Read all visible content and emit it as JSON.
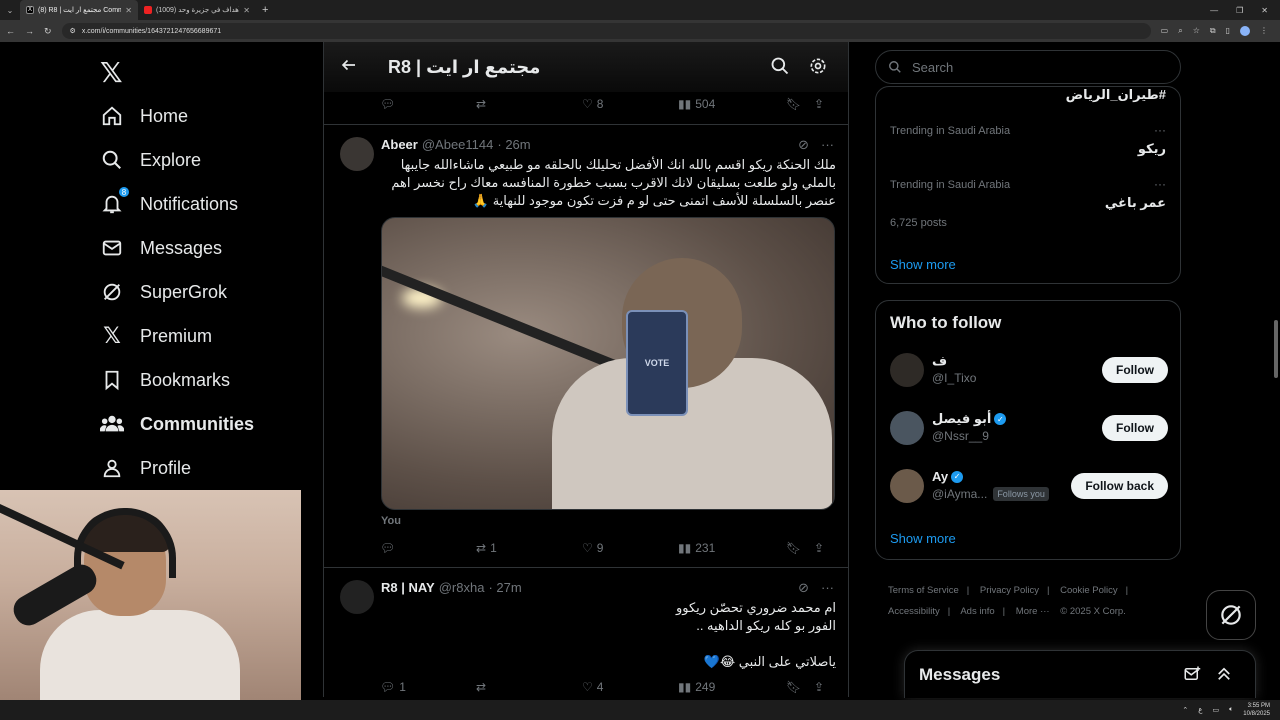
{
  "browser": {
    "tabs": [
      {
        "title": "(8) R8 | مجتمع ار ايت Communi...",
        "active": true
      },
      {
        "title": "(1009) كل الأهداف في جزيرة وحد...",
        "active": false
      }
    ],
    "url": "x.com/i/communities/1643721247656689671"
  },
  "sidebar": {
    "notifications_badge": "8",
    "items": [
      {
        "label": "Home",
        "icon": "home-icon"
      },
      {
        "label": "Explore",
        "icon": "search-icon"
      },
      {
        "label": "Notifications",
        "icon": "bell-icon"
      },
      {
        "label": "Messages",
        "icon": "mail-icon"
      },
      {
        "label": "SuperGrok",
        "icon": "grok-icon"
      },
      {
        "label": "Premium",
        "icon": "x-premium-icon"
      },
      {
        "label": "Bookmarks",
        "icon": "bookmark-icon"
      },
      {
        "label": "Communities",
        "icon": "communities-icon"
      },
      {
        "label": "Profile",
        "icon": "profile-icon"
      }
    ]
  },
  "header": {
    "title": "R8 | مجتمع ار ايت"
  },
  "posts": [
    {
      "stats": {
        "replies": "",
        "reposts": "",
        "likes": "8",
        "views": "504"
      }
    },
    {
      "name": "Abeer",
      "handle": "@Abee1144",
      "time": "· 26m",
      "text_lines": [
        "ملك الحنكة ريكو اقسم بالله انك الأفضل تحليلك بالحلقه مو طبيعي ماشاءالله جايبها",
        "بالملي ولو  طلعت بسليقان لانك الاقرب بسبب خطورة المنافسه معاك راح نخسر اهم",
        "عنصر بالسلسلة للأسف اتمنى حتى لو م فزت تكون موجود للنهاية 🙏"
      ],
      "media_card_text": "VOTE",
      "media_label": "You",
      "stats": {
        "replies": "",
        "reposts": "1",
        "likes": "9",
        "views": "231"
      }
    },
    {
      "name": "R8 | NAY",
      "handle": "@r8xha",
      "time": "· 27m",
      "text_lines": [
        "ام محمد ضروري تحصّن ريكوو",
        "الفور بو كله ريكو الداهيه ..",
        "",
        "ياصلاتي على النبي 😂💙"
      ],
      "stats": {
        "replies": "1",
        "reposts": "",
        "likes": "4",
        "views": "249"
      }
    }
  ],
  "right": {
    "search_placeholder": "Search",
    "trends": [
      {
        "context": "",
        "title": "#طيران_الرياض",
        "posts": ""
      },
      {
        "context": "Trending in Saudi Arabia",
        "title": "ريكو",
        "posts": ""
      },
      {
        "context": "Trending in Saudi Arabia",
        "title": "عمر باغي",
        "posts": "6,725 posts"
      }
    ],
    "show_more": "Show more",
    "who_to_follow": {
      "title": "Who to follow",
      "accounts": [
        {
          "name": "ف",
          "handle": "@I_Tixo",
          "verified": false,
          "follows_you": "",
          "button": "Follow"
        },
        {
          "name": "أبو فيصل",
          "handle": "@Nssr__9",
          "verified": true,
          "follows_you": "",
          "button": "Follow"
        },
        {
          "name": "Ay",
          "handle": "@iAyma...",
          "verified": true,
          "follows_you": "Follows you",
          "button": "Follow back"
        }
      ],
      "show_more": "Show more"
    },
    "footer": [
      "Terms of Service",
      "|",
      "Privacy Policy",
      "|",
      "Cookie Policy",
      "|",
      "Accessibility",
      "|",
      "Ads info",
      "|",
      "More ···",
      "© 2025 X Corp."
    ]
  },
  "messages_drawer": {
    "title": "Messages"
  },
  "taskbar": {
    "time": "3:55 PM",
    "date": "10/8/2025",
    "lang": "ع"
  }
}
